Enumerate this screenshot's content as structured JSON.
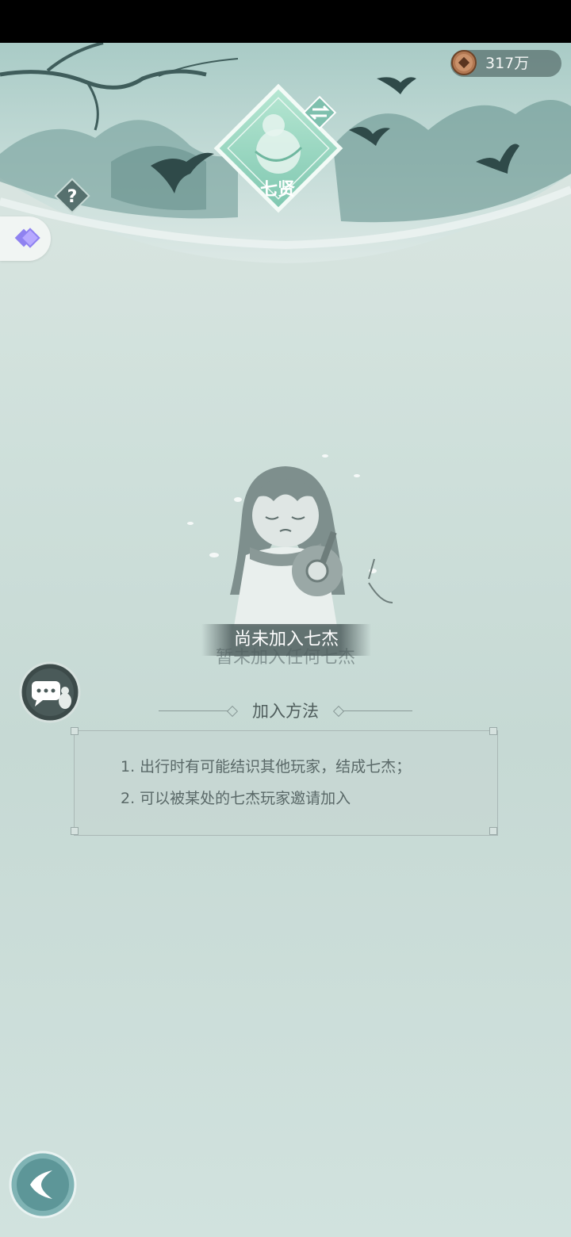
{
  "currency": {
    "amount": "317万",
    "icon": "copper-coin-icon"
  },
  "emblem": {
    "label": "七贤",
    "icon": "gourd-emblem-icon"
  },
  "status": {
    "title": "尚未加入七杰",
    "subtitle": "暂未加入任何七杰"
  },
  "join_method": {
    "title": "加入方法",
    "steps": [
      "1. 出行时有可能结识其他玩家，结成七杰；",
      "2. 可以被某处的七杰玩家邀请加入"
    ]
  },
  "icons": {
    "help": "question-icon",
    "swap": "swap-icon",
    "side_toggle": "diamond-toggle-icon",
    "chat": "chat-bubble-icon",
    "back": "back-arrow-icon"
  },
  "colors": {
    "background": "#cfe0db",
    "accent": "#7fc7b0",
    "text_dark": "#4f5d5c",
    "side_toggle": "#8f82f0"
  }
}
